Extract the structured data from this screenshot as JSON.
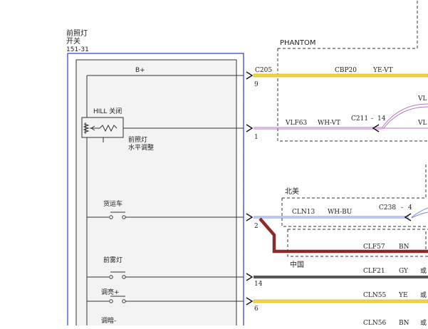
{
  "component": {
    "name_line1": "前照灯",
    "name_line2": "开关",
    "code": "151-31"
  },
  "region_labels": {
    "phantom": "PHANTOM",
    "north_america": "北美",
    "china": "中国"
  },
  "switch_labels": {
    "b_plus": "B+",
    "hill_off": "HILL 关闭",
    "headlamp_leveling_line1": "前照灯",
    "headlamp_leveling_line2": "水平调整",
    "truck": "货运车",
    "front_fog": "前雾灯",
    "dim_up": "调亮+",
    "dim_down": "调暗-"
  },
  "connectors": {
    "c205": "C205",
    "c211": "C211",
    "c211_pin": "14",
    "c238": "C238",
    "c238_pin": "4"
  },
  "pins": [
    "9",
    "1",
    "2",
    "14",
    "6"
  ],
  "wires": [
    {
      "circuit": "CBP20",
      "color_code": "YE-VT"
    },
    {
      "circuit": "VLF63",
      "color_code": "WH-VT"
    },
    {
      "circuit": "CLN13",
      "color_code": "WH-BU"
    },
    {
      "circuit": "CLF57",
      "color_code": "BN"
    },
    {
      "circuit": "CLF21",
      "color_code": "GY"
    },
    {
      "circuit": "CLN55",
      "color_code": "YE"
    },
    {
      "circuit": "CLN56",
      "color_code": "BN"
    }
  ],
  "truncated": {
    "vl_top": "VL",
    "vl_mid": "VL",
    "r1": "或",
    "r2": "或",
    "r3": "或"
  },
  "colors": {
    "box_border": "#2b3bd6",
    "yellow_wire": "#f2d640",
    "violet_wire": "#b874c8",
    "blue_wire": "#7d8ed8",
    "brown_wire": "#8a2a2a",
    "gray_wire": "#555555"
  }
}
